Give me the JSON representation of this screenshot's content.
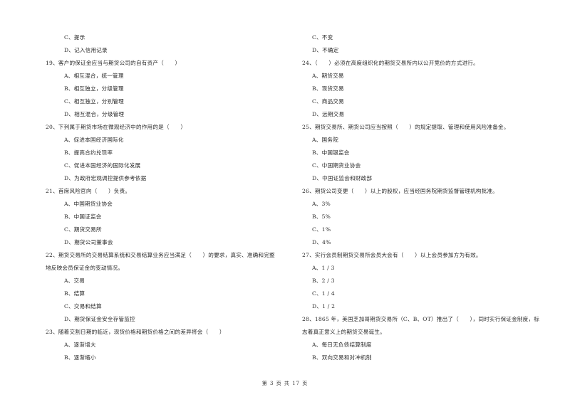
{
  "left_column": [
    {
      "type": "option",
      "text": "C、提示"
    },
    {
      "type": "option",
      "text": "D、记入信用记录"
    },
    {
      "type": "question",
      "text": "19、客户的保证金应当与期货公司的自有资产（　　）"
    },
    {
      "type": "option",
      "text": "A、相互混合，统一管理"
    },
    {
      "type": "option",
      "text": "B、相互独立，分级管理"
    },
    {
      "type": "option",
      "text": "C、相互独立，分别管理"
    },
    {
      "type": "option",
      "text": "D、相互混合，分级管理"
    },
    {
      "type": "question",
      "text": "20、下列属于期货市场在微观经济中的作用的是（　　）"
    },
    {
      "type": "option",
      "text": "A、促进本国经济国际化"
    },
    {
      "type": "option",
      "text": "B、提高合约兑现率"
    },
    {
      "type": "option",
      "text": "C、促进本国经济的国际化发展"
    },
    {
      "type": "option",
      "text": "D、为政府宏观调控提供参考依据"
    },
    {
      "type": "question",
      "text": "21、首席风险官向（　　）负责。"
    },
    {
      "type": "option",
      "text": "A、中国期货业协会"
    },
    {
      "type": "option",
      "text": "B、中国证监会"
    },
    {
      "type": "option",
      "text": "C、期货交易所"
    },
    {
      "type": "option",
      "text": "D、期货公司董事会"
    },
    {
      "type": "question",
      "text": "22、期货交易所的交易结算系统和交易结算业务应当满足（　　）的要求，真实、准确和完整"
    },
    {
      "type": "question-cont",
      "text": "地反映会员保证金的变动情况。"
    },
    {
      "type": "option",
      "text": "A、交易"
    },
    {
      "type": "option",
      "text": "B、结算"
    },
    {
      "type": "option",
      "text": "C、交易和结算"
    },
    {
      "type": "option",
      "text": "D、期货保证金安全存管监控"
    },
    {
      "type": "question",
      "text": "23、随着交割日期的临近，现货价格和期货价格之间的差异将会（　　）"
    },
    {
      "type": "option",
      "text": "A、逐渐增大"
    },
    {
      "type": "option",
      "text": "B、逐渐缩小"
    }
  ],
  "right_column": [
    {
      "type": "option",
      "text": "C、不变"
    },
    {
      "type": "option",
      "text": "D、不确定"
    },
    {
      "type": "question",
      "text": "24、（　　）必须在高度组织化的期货交易所内以公开竞价的方式进行。"
    },
    {
      "type": "option",
      "text": "A、期货交易"
    },
    {
      "type": "option",
      "text": "B、现货交易"
    },
    {
      "type": "option",
      "text": "C、商品交易"
    },
    {
      "type": "option",
      "text": "D、远期交易"
    },
    {
      "type": "question",
      "text": "25、期货交易所、期货公司应当按照（　　）的规定提取、管理和使用风险准备金。"
    },
    {
      "type": "option",
      "text": "A、国务院"
    },
    {
      "type": "option",
      "text": "B、中国银监会"
    },
    {
      "type": "option",
      "text": "C、中国期货业协会"
    },
    {
      "type": "option",
      "text": "D、中国证监会和财政部"
    },
    {
      "type": "question",
      "text": "26、期货公司变更（　　）以上的股权，应当经国务院期货监督管理机构批准。"
    },
    {
      "type": "option",
      "text": "A、3%"
    },
    {
      "type": "option",
      "text": "B、5%"
    },
    {
      "type": "option",
      "text": "C、1%"
    },
    {
      "type": "option",
      "text": "D、4%"
    },
    {
      "type": "question",
      "text": "27、实行会员制期货交易所会员大会有（　　）以上会员参加方为有效。"
    },
    {
      "type": "option",
      "text": "A、1 / 3"
    },
    {
      "type": "option",
      "text": "B、2 / 3"
    },
    {
      "type": "option",
      "text": "C、1 / 4"
    },
    {
      "type": "option",
      "text": "D、1 / 2"
    },
    {
      "type": "question",
      "text": "28、1865 年，美国芝加哥期货交易所（C、B、OT）推出了（　　），同时实行保证金制度，标"
    },
    {
      "type": "question-cont",
      "text": "志着真正意义上的期货交易诞生。"
    },
    {
      "type": "option",
      "text": "A、每日无负债结算制度"
    },
    {
      "type": "option",
      "text": "B、双向交易和对冲机制"
    }
  ],
  "footer": {
    "page_label": "第 3 页 共 17 页"
  }
}
